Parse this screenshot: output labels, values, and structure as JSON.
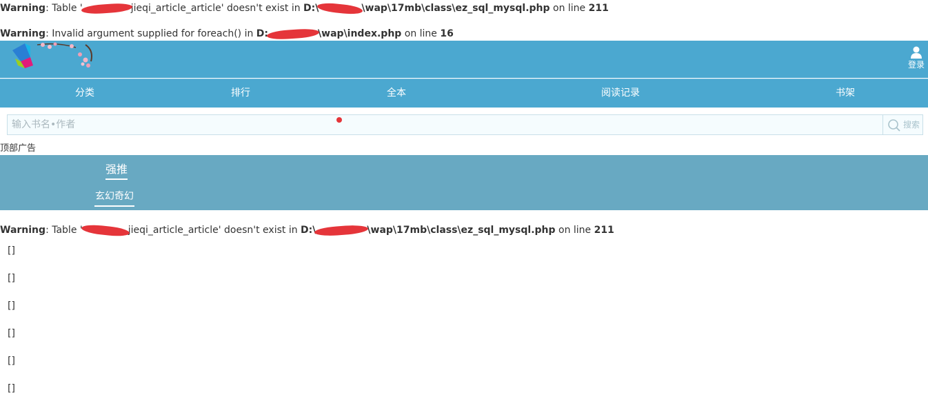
{
  "warnings": [
    {
      "label": "Warning",
      "pre": ": Table '",
      "post": "jieqi_article_article' doesn't exist in ",
      "path_prefix": "D:\\",
      "path_suffix": "\\wap\\17mb\\class\\ez_sql_mysql.php",
      "mid": " on line ",
      "line": "211"
    },
    {
      "label": "Warning",
      "pre": ": Invalid argument supplied for foreach() in ",
      "post": "",
      "path_prefix": "D:",
      "path_suffix": "\\wap\\index.php",
      "mid": " on line ",
      "line": "16"
    },
    {
      "label": "Warning",
      "pre": ": Table '",
      "post": "jieqi_article_article' doesn't exist in ",
      "path_prefix": "D:\\",
      "path_suffix": "\\wap\\17mb\\class\\ez_sql_mysql.php",
      "mid": " on line ",
      "line": "211"
    }
  ],
  "header": {
    "login_label": "登录",
    "logo_icon": "site-logo-blossom",
    "user_icon": "user-icon"
  },
  "nav": {
    "items": [
      "分类",
      "排行",
      "全本",
      "阅读记录",
      "书架"
    ]
  },
  "search": {
    "placeholder": "输入书名•作者",
    "button_label": "搜索",
    "icon": "search-icon"
  },
  "ad": {
    "label": "顶部广告"
  },
  "recommend": {
    "title": "强推",
    "category": "玄幻奇幻"
  },
  "list": {
    "items": [
      "[]",
      "[]",
      "[]",
      "[]",
      "[]",
      "[]"
    ]
  },
  "colors": {
    "header_bg": "#4ba8d0",
    "recommend_bg": "#68a9c2",
    "redaction": "#e5353a"
  }
}
